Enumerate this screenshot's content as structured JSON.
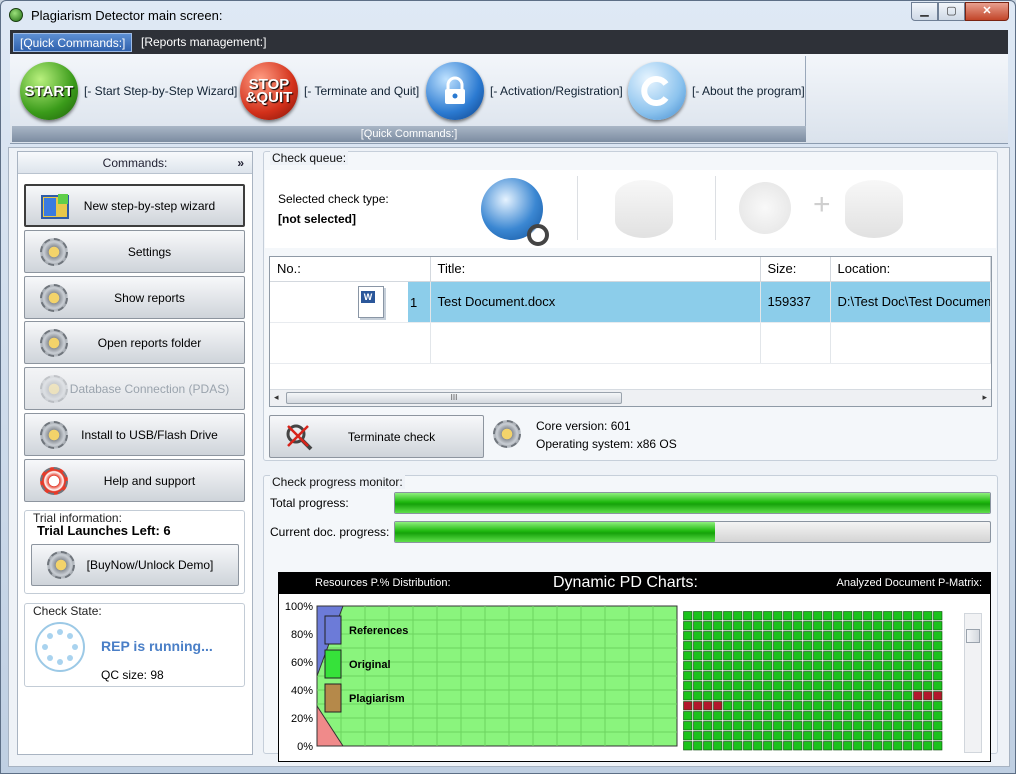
{
  "window": {
    "title": "Plagiarism Detector main screen:",
    "min": "▁",
    "max": "▢",
    "close": "✕"
  },
  "menu": {
    "tabs": [
      "[Quick Commands:]",
      "[Reports management:]"
    ]
  },
  "ribbon": {
    "buttons": [
      {
        "icon_text": "START",
        "label": "[- Start Step-by-Step Wizard]"
      },
      {
        "icon_text": "STOP &QUIT",
        "label": "[- Terminate and Quit]"
      },
      {
        "icon_text": "",
        "label": "[- Activation/Registration]"
      },
      {
        "icon_text": "",
        "label": "[- About the program]"
      }
    ],
    "group_caption": "[Quick Commands:]"
  },
  "commands": {
    "header": "Commands:",
    "collapse": "»",
    "items": [
      {
        "label": "New step-by-step wizard",
        "state": "selected"
      },
      {
        "label": "Settings",
        "state": "normal"
      },
      {
        "label": "Show reports",
        "state": "normal"
      },
      {
        "label": "Open reports folder",
        "state": "normal"
      },
      {
        "label": "Database Connection (PDAS)",
        "state": "disabled"
      },
      {
        "label": "Install to USB/Flash Drive",
        "state": "normal"
      },
      {
        "label": "Help and support",
        "state": "normal"
      }
    ]
  },
  "trial": {
    "caption": "Trial information:",
    "launches": "Trial Launches Left: 6",
    "buy_label": "[BuyNow/Unlock Demo]"
  },
  "check_state": {
    "caption": "Check State:",
    "status": "REP is running...",
    "qc": "QC size: 98"
  },
  "queue": {
    "caption": "Check queue:",
    "type_label": "Selected check type:",
    "type_value": "[not selected]",
    "plus": "+",
    "columns": [
      "No.:",
      "Title:",
      "Size:",
      "Location:"
    ],
    "rows": [
      {
        "no": "1",
        "title": "Test Document.docx",
        "size": "159337",
        "location": "D:\\Test Doc\\Test Document.docx"
      }
    ],
    "scroll_grip": "III",
    "left_arrow": "◂",
    "right_arrow": "▸"
  },
  "terminate": {
    "label": "Terminate check"
  },
  "core": {
    "version": "Core version: 601",
    "os": "Operating system: x86 OS"
  },
  "progress": {
    "caption": "Check progress monitor:",
    "total_label": "Total progress:",
    "total_value": 1.0,
    "current_label": "Current doc. progress:",
    "current_value": 0.537
  },
  "chart_data": {
    "type": "area",
    "title": "Dynamic PD Charts:",
    "left_title": "Resources P.% Distribution:",
    "right_title": "Analyzed Document P-Matrix:",
    "ylabel": "",
    "xlabel": "",
    "yticks": [
      "100%",
      "80%",
      "60%",
      "40%",
      "20%",
      "0%"
    ],
    "ylim": [
      0,
      100
    ],
    "series": [
      {
        "name": "References",
        "color": "#6c7bd8"
      },
      {
        "name": "Original",
        "color": "#36e23a"
      },
      {
        "name": "Plagiarism",
        "color": "#b5894a"
      }
    ],
    "area_fill": "#8af47d",
    "matrix": {
      "cols": 26,
      "rows": 14,
      "green": "#1bc21c",
      "red": "#b2172d",
      "red_cells": [
        [
          9,
          0
        ],
        [
          9,
          1
        ],
        [
          9,
          2
        ],
        [
          9,
          3
        ],
        [
          8,
          23
        ],
        [
          8,
          24
        ],
        [
          8,
          25
        ]
      ]
    }
  },
  "colors": {
    "accent_blue": "#4079c4",
    "status_blue": "#4a7fc7",
    "highlight": "#8ccdea"
  }
}
